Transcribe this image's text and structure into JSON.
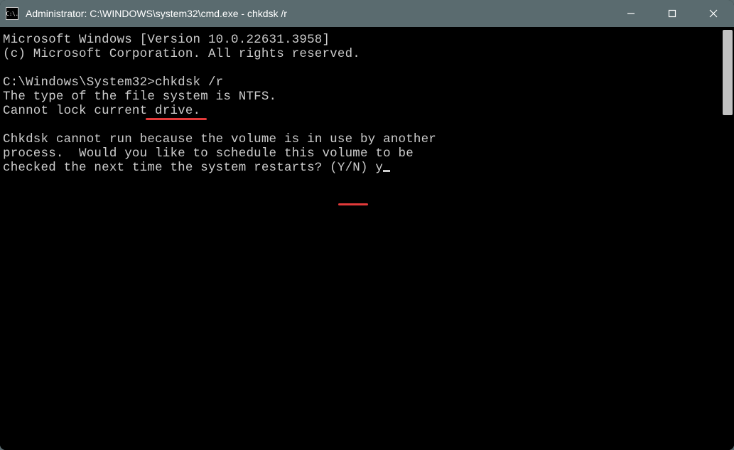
{
  "window": {
    "title": "Administrator: C:\\WINDOWS\\system32\\cmd.exe - chkdsk  /r",
    "icon_label": "C:\\."
  },
  "terminal": {
    "line1": "Microsoft Windows [Version 10.0.22631.3958]",
    "line2": "(c) Microsoft Corporation. All rights reserved.",
    "line3": "",
    "prompt_path": "C:\\Windows\\System32>",
    "command": "chkdsk /r",
    "line5": "The type of the file system is NTFS.",
    "line6": "Cannot lock current drive.",
    "line7": "",
    "line8": "Chkdsk cannot run because the volume is in use by another",
    "line9": "process.  Would you like to schedule this volume to be",
    "line10_prefix": "checked the next time the system restarts? (Y/N) ",
    "user_input": "y"
  }
}
